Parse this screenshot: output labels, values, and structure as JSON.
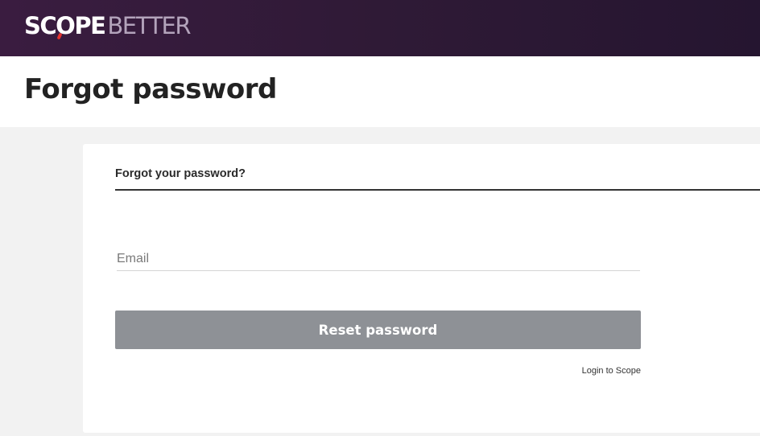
{
  "header": {
    "logo_part1": "SCOPE",
    "logo_part2": "BETTER"
  },
  "page": {
    "title": "Forgot password"
  },
  "form": {
    "heading": "Forgot your password?",
    "email_placeholder": "Email",
    "email_value": "",
    "submit_label": "Reset password",
    "login_link_label": "Login to Scope"
  },
  "colors": {
    "header_bg": "#2f1a36",
    "logo_accent": "#e5322d",
    "button_bg": "#8e9196"
  }
}
